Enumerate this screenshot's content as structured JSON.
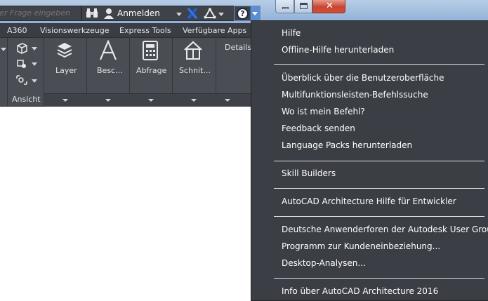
{
  "titlebar": {
    "search_placeholder": "ler Frage eingeben",
    "signin_label": "Anmelden",
    "close_glyph": "✕",
    "help_glyph": "?",
    "icons": [
      "binoculars-icon",
      "user-icon",
      "exchange-x-icon",
      "a360-triangle-icon",
      "help-icon"
    ]
  },
  "tabs": [
    {
      "label": "A360"
    },
    {
      "label": "Visionswerkzeuge"
    },
    {
      "label": "Express Tools"
    },
    {
      "label": "Verfügbare Apps"
    }
  ],
  "ribbon": {
    "ansicht_label": "Ansicht",
    "panels": [
      {
        "label": "Layer",
        "icon": "layer-stack-icon"
      },
      {
        "label": "Besc...",
        "icon": "annotation-a-icon"
      },
      {
        "label": "Abfrage",
        "icon": "calculator-icon"
      },
      {
        "label": "Schnit...",
        "icon": "section-house-icon"
      },
      {
        "label": "Details",
        "icon": ""
      }
    ]
  },
  "menu": {
    "groups": [
      [
        "Hilfe",
        "Offline-Hilfe herunterladen"
      ],
      [
        "Überblick über die Benutzeroberfläche",
        "Multifunktionsleisten-Befehlssuche",
        "Wo ist mein Befehl?",
        "Feedback senden",
        "Language Packs herunterladen"
      ],
      [
        "Skill Builders"
      ],
      [
        "AutoCAD Architecture Hilfe für Entwickler"
      ],
      [
        "Deutsche Anwenderforen der Autodesk User Group",
        "Programm zur Kundeneinbeziehung...",
        "Desktop-Analysen..."
      ],
      [
        "Info über AutoCAD Architecture 2016"
      ]
    ]
  },
  "colors": {
    "ribbon_bg": "#4a4d54",
    "menu_bg": "#3b3e44",
    "titlebar_blue": "#9fbbdc",
    "close_red": "#c9452f",
    "help_accent": "#5b8ed0"
  }
}
